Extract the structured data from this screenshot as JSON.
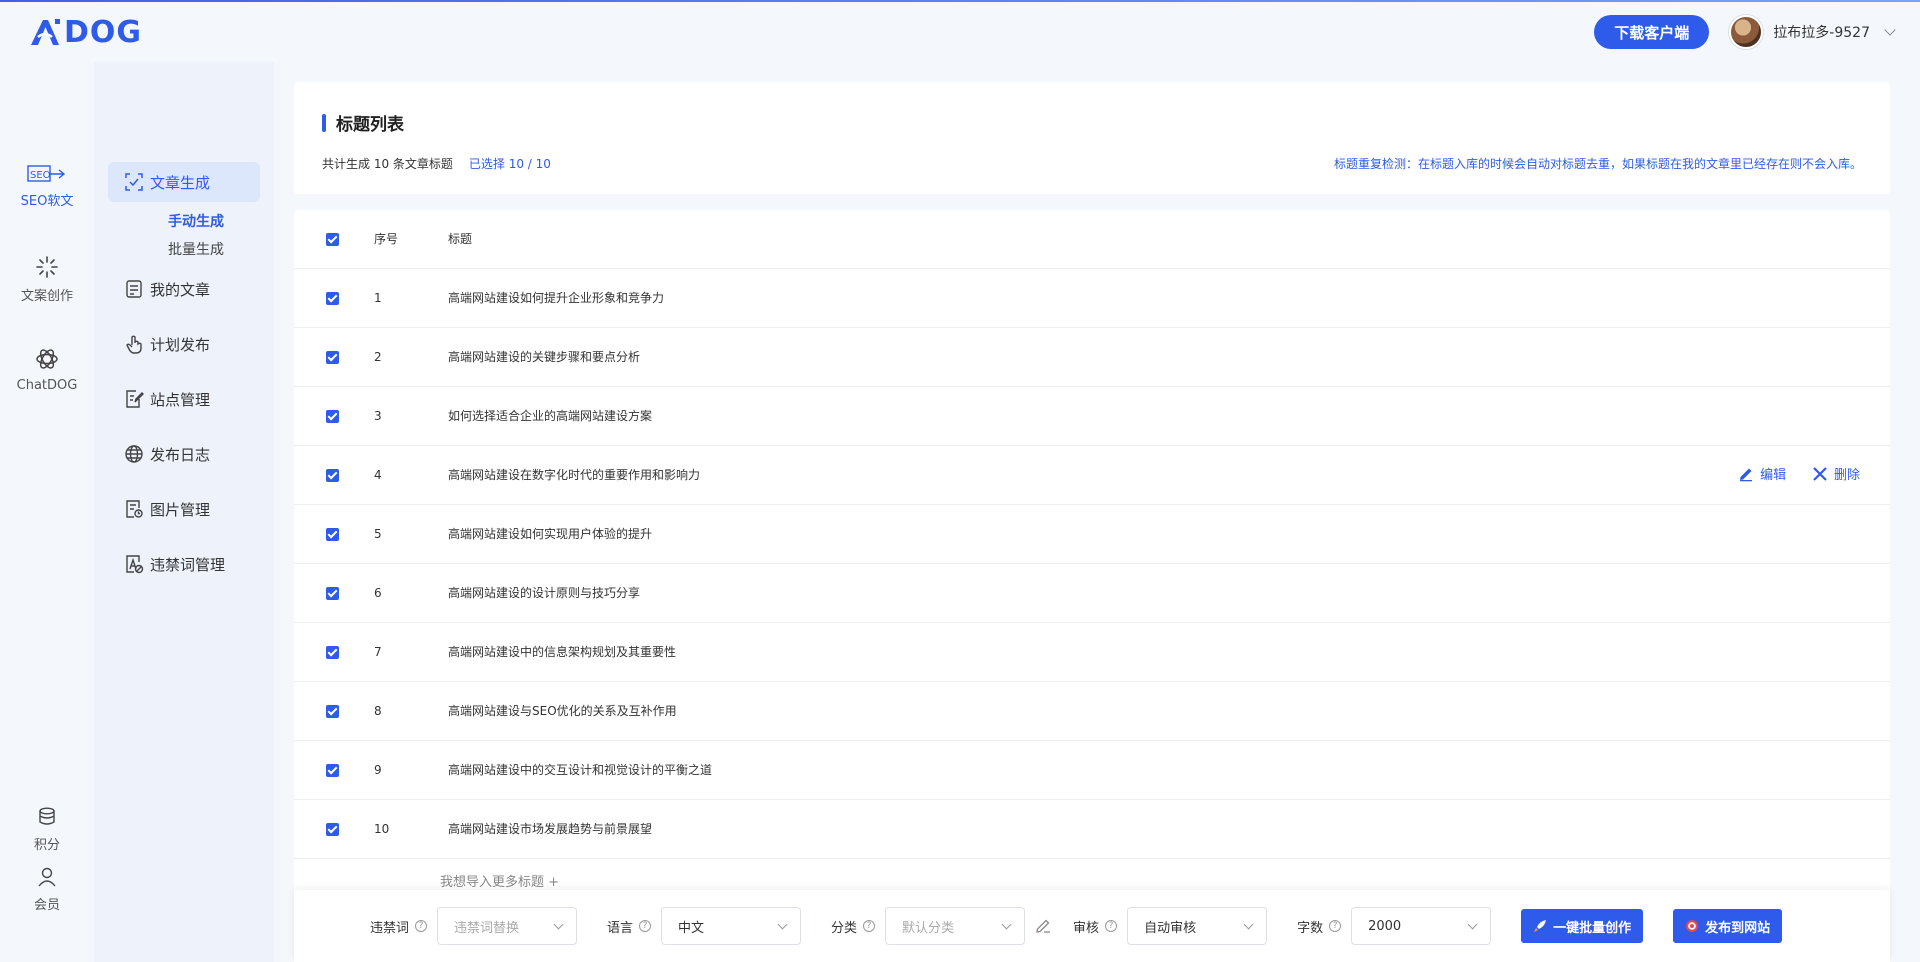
{
  "app": {
    "logo_text": "DOG",
    "brand_color": "#2f5bea",
    "download_button": "下载客户端",
    "username": "拉布拉多-9527"
  },
  "rail": {
    "items": [
      {
        "label": "SEO软文",
        "icon": "seo-pen-icon"
      },
      {
        "label": "文案创作",
        "icon": "sparkle-icon"
      },
      {
        "label": "ChatDOG",
        "icon": "chatgpt-icon"
      }
    ],
    "bottom": [
      {
        "label": "积分",
        "icon": "coins-icon"
      },
      {
        "label": "会员",
        "icon": "user-icon"
      }
    ]
  },
  "sidebar": {
    "items": [
      {
        "label": "文章生成",
        "icon": "check-frame-icon"
      },
      {
        "label": "我的文章",
        "icon": "document-icon"
      },
      {
        "label": "计划发布",
        "icon": "hand-pointer-icon"
      },
      {
        "label": "站点管理",
        "icon": "edit-doc-icon"
      },
      {
        "label": "发布日志",
        "icon": "globe-icon"
      },
      {
        "label": "图片管理",
        "icon": "image-doc-icon"
      },
      {
        "label": "违禁词管理",
        "icon": "forbidden-word-icon"
      }
    ],
    "sub_items": [
      {
        "label": "手动生成"
      },
      {
        "label": "批量生成"
      }
    ]
  },
  "header_panel": {
    "title": "标题列表",
    "total_text": "共计生成 10 条文章标题",
    "selected_text": "已选择 10 / 10",
    "dup_note": "标题重复检测：在标题入库的时候会自动对标题去重，如果标题在我的文章里已经存在则不会入库。"
  },
  "table": {
    "col_no": "序号",
    "col_title": "标题",
    "rows": [
      {
        "no": "1",
        "title": "高端网站建设如何提升企业形象和竞争力"
      },
      {
        "no": "2",
        "title": "高端网站建设的关键步骤和要点分析"
      },
      {
        "no": "3",
        "title": "如何选择适合企业的高端网站建设方案"
      },
      {
        "no": "4",
        "title": "高端网站建设在数字化时代的重要作用和影响力"
      },
      {
        "no": "5",
        "title": "高端网站建设如何实现用户体验的提升"
      },
      {
        "no": "6",
        "title": "高端网站建设的设计原则与技巧分享"
      },
      {
        "no": "7",
        "title": "高端网站建设中的信息架构规划及其重要性"
      },
      {
        "no": "8",
        "title": "高端网站建设与SEO优化的关系及互补作用"
      },
      {
        "no": "9",
        "title": "高端网站建设中的交互设计和视觉设计的平衡之道"
      },
      {
        "no": "10",
        "title": "高端网站建设市场发展趋势与前景展望"
      }
    ],
    "edit_label": "编辑",
    "delete_label": "删除",
    "import_more": "我想导入更多标题 +"
  },
  "bottom_bar": {
    "forbidden_label": "违禁词",
    "forbidden_placeholder": "违禁词替换",
    "language_label": "语言",
    "language_value": "中文",
    "category_label": "分类",
    "category_placeholder": "默认分类",
    "review_label": "审核",
    "review_value": "自动审核",
    "words_label": "字数",
    "words_value": "2000",
    "batch_button": "一键批量创作",
    "publish_button": "发布到网站"
  }
}
